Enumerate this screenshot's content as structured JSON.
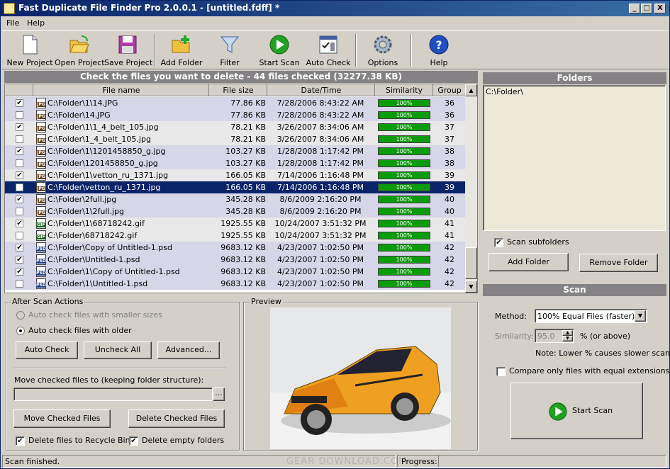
{
  "window": {
    "title": "Fast Duplicate File Finder Pro 2.0.0.1 - [untitled.fdff] *",
    "min": "_",
    "max": "□",
    "close": "X"
  },
  "menu": {
    "file": "File",
    "help": "Help"
  },
  "toolbar": [
    {
      "label": "New Project",
      "icon": "new-project-icon"
    },
    {
      "label": "Open Project",
      "icon": "open-project-icon"
    },
    {
      "label": "Save Project",
      "icon": "save-project-icon"
    },
    {
      "label": "Add Folder",
      "icon": "add-folder-icon"
    },
    {
      "label": "Filter",
      "icon": "filter-icon"
    },
    {
      "label": "Start Scan",
      "icon": "start-scan-icon"
    },
    {
      "label": "Auto Check",
      "icon": "auto-check-icon"
    },
    {
      "label": "Options",
      "icon": "options-icon"
    },
    {
      "label": "Help",
      "icon": "help-icon"
    }
  ],
  "results": {
    "header": "Check the files you want to delete - 44 files checked (32277.38 KB)",
    "columns": [
      "File name",
      "File size",
      "Date/Time",
      "Similarity",
      "Group"
    ],
    "rows": [
      {
        "checked": true,
        "type": "JPG",
        "name": "C:\\Folder\\1\\14.JPG",
        "size": "77.86 KB",
        "date": "7/28/2006 8:43:22 AM",
        "sim": "100%",
        "group": "36",
        "selected": false
      },
      {
        "checked": false,
        "type": "JPG",
        "name": "C:\\Folder\\14.JPG",
        "size": "77.86 KB",
        "date": "7/28/2006 8:43:22 AM",
        "sim": "100%",
        "group": "36",
        "selected": false
      },
      {
        "checked": true,
        "type": "JPG",
        "name": "C:\\Folder\\1\\1_4_belt_105.jpg",
        "size": "78.21 KB",
        "date": "3/26/2007 8:34:06 AM",
        "sim": "100%",
        "group": "37",
        "selected": false
      },
      {
        "checked": false,
        "type": "JPG",
        "name": "C:\\Folder\\1_4_belt_105.jpg",
        "size": "78.21 KB",
        "date": "3/26/2007 8:34:06 AM",
        "sim": "100%",
        "group": "37",
        "selected": false
      },
      {
        "checked": true,
        "type": "JPG",
        "name": "C:\\Folder\\1\\1201458850_g.jpg",
        "size": "103.27 KB",
        "date": "1/28/2008 1:17:42 PM",
        "sim": "100%",
        "group": "38",
        "selected": false
      },
      {
        "checked": false,
        "type": "JPG",
        "name": "C:\\Folder\\1201458850_g.jpg",
        "size": "103.27 KB",
        "date": "1/28/2008 1:17:42 PM",
        "sim": "100%",
        "group": "38",
        "selected": false
      },
      {
        "checked": true,
        "type": "JPG",
        "name": "C:\\Folder\\1\\vetton_ru_1371.jpg",
        "size": "166.05 KB",
        "date": "7/14/2006 1:16:48 PM",
        "sim": "100%",
        "group": "39",
        "selected": false
      },
      {
        "checked": false,
        "type": "JPG",
        "name": "C:\\Folder\\vetton_ru_1371.jpg",
        "size": "166.05 KB",
        "date": "7/14/2006 1:16:48 PM",
        "sim": "100%",
        "group": "39",
        "selected": true
      },
      {
        "checked": true,
        "type": "JPG",
        "name": "C:\\Folder\\2full.jpg",
        "size": "345.28 KB",
        "date": "8/6/2009 2:16:20 PM",
        "sim": "100%",
        "group": "40",
        "selected": false
      },
      {
        "checked": false,
        "type": "JPG",
        "name": "C:\\Folder\\1\\2full.jpg",
        "size": "345.28 KB",
        "date": "8/6/2009 2:16:20 PM",
        "sim": "100%",
        "group": "40",
        "selected": false
      },
      {
        "checked": true,
        "type": "GIF",
        "name": "C:\\Folder\\1\\68718242.gif",
        "size": "1925.55 KB",
        "date": "10/24/2007 3:51:32 PM",
        "sim": "100%",
        "group": "41",
        "selected": false
      },
      {
        "checked": false,
        "type": "GIF",
        "name": "C:\\Folder\\68718242.gif",
        "size": "1925.55 KB",
        "date": "10/24/2007 3:51:32 PM",
        "sim": "100%",
        "group": "41",
        "selected": false
      },
      {
        "checked": true,
        "type": "PSD",
        "name": "C:\\Folder\\Copy of Untitled-1.psd",
        "size": "9683.12 KB",
        "date": "4/23/2007 1:02:50 PM",
        "sim": "100%",
        "group": "42",
        "selected": false
      },
      {
        "checked": true,
        "type": "PSD",
        "name": "C:\\Folder\\Untitled-1.psd",
        "size": "9683.12 KB",
        "date": "4/23/2007 1:02:50 PM",
        "sim": "100%",
        "group": "42",
        "selected": false
      },
      {
        "checked": true,
        "type": "PSD",
        "name": "C:\\Folder\\1\\Copy of Untitled-1.psd",
        "size": "9683.12 KB",
        "date": "4/23/2007 1:02:50 PM",
        "sim": "100%",
        "group": "42",
        "selected": false
      },
      {
        "checked": false,
        "type": "PSD",
        "name": "C:\\Folder\\1\\Untitled-1.psd",
        "size": "9683.12 KB",
        "date": "4/23/2007 1:02:50 PM",
        "sim": "100%",
        "group": "42",
        "selected": false
      }
    ]
  },
  "after_scan": {
    "legend": "After Scan Actions",
    "opt_smaller": "Auto check files with smaller sizes",
    "opt_older": "Auto check files with older dates",
    "auto_check": "Auto Check",
    "uncheck_all": "Uncheck All",
    "advanced": "Advanced...",
    "move_label": "Move checked files to (keeping folder structure):",
    "move_value": "",
    "browse": "...",
    "move_btn": "Move Checked Files",
    "delete_btn": "Delete Checked Files",
    "recycle": "Delete files to Recycle Bin",
    "empty_folders": "Delete empty folders"
  },
  "preview": {
    "legend": "Preview"
  },
  "folders": {
    "header": "Folders",
    "items": [
      "C:\\Folder\\"
    ],
    "scan_subfolders": "Scan subfolders",
    "add": "Add Folder",
    "remove": "Remove Folder"
  },
  "scan": {
    "header": "Scan",
    "method_label": "Method:",
    "method_value": "100% Equal Files (faster)",
    "similarity_label": "Similarity:",
    "similarity_value": "95.0",
    "similarity_suffix": "% (or above)",
    "note": "Note: Lower % causes slower scan",
    "compare_ext": "Compare only files with equal extensions",
    "start": "Start Scan"
  },
  "status": {
    "text": "Scan finished.",
    "progress_label": "Progress:",
    "watermark": "GEAR DOWNLOAD.COM"
  },
  "colors": {
    "title_start": "#0a246a",
    "title_end": "#3a6ea5",
    "header_gray": "#848284",
    "row_a": "#d6d6e8",
    "row_b": "#e8e8e8",
    "selected": "#0a246a",
    "sim_green": "#0b9c0b"
  }
}
